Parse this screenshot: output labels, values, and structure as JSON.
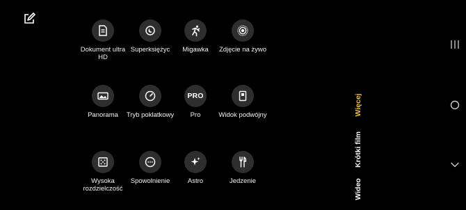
{
  "top_bar": {
    "edit_icon": "edit-icon"
  },
  "modes": [
    {
      "id": "dokument-ultra-hd",
      "label": "Dokument ultra\nHD",
      "icon": "document-icon"
    },
    {
      "id": "superksiezyc",
      "label": "Superksiężyc",
      "icon": "moon-icon"
    },
    {
      "id": "migawka",
      "label": "Migawka",
      "icon": "running-person-icon"
    },
    {
      "id": "zdjecie-na-zywo",
      "label": "Zdjęcie na żywo",
      "icon": "live-photo-icon"
    },
    {
      "id": "panorama",
      "label": "Panorama",
      "icon": "panorama-icon"
    },
    {
      "id": "tryb-poklatkowy",
      "label": "Tryb poklatkowy",
      "icon": "timelapse-icon"
    },
    {
      "id": "pro",
      "label": "Pro",
      "icon": "pro-icon",
      "icon_text": "PRO"
    },
    {
      "id": "widok-podwojny",
      "label": "Widok podwójny",
      "icon": "dual-view-icon"
    },
    {
      "id": "wysoka-rozdzielczosc",
      "label": "Wysoka\nrozdzielczość",
      "icon": "high-resolution-icon"
    },
    {
      "id": "spowolnienie",
      "label": "Spowolnienie",
      "icon": "slow-motion-icon"
    },
    {
      "id": "astro",
      "label": "Astro",
      "icon": "sparkle-icon"
    },
    {
      "id": "jedzenie",
      "label": "Jedzenie",
      "icon": "fork-knife-icon"
    }
  ],
  "tabs": [
    {
      "label": "Więcej",
      "active": true
    },
    {
      "label": "Krótki film",
      "active": false
    },
    {
      "label": "Wideo",
      "active": false
    }
  ],
  "nav_buttons": [
    "recent-apps-icon",
    "home-icon",
    "back-icon"
  ],
  "colors": {
    "active_tab": "#f1c232",
    "icon_bg": "#2e2e2e",
    "background": "#000000"
  }
}
